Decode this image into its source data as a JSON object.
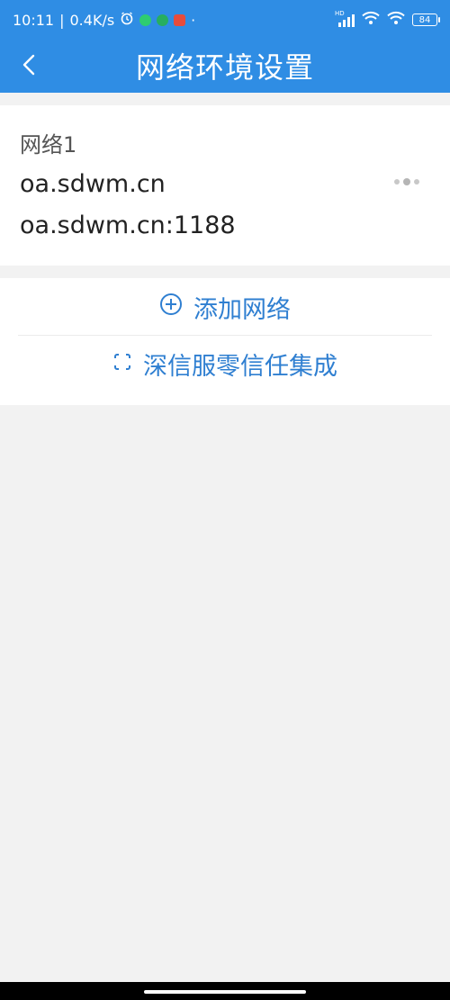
{
  "status_bar": {
    "time": "10:11",
    "separator": "|",
    "speed": "0.4K/s",
    "dot": "·",
    "battery": "84",
    "network_badge": "HD",
    "icons": [
      "alarm-icon",
      "wechat-icon",
      "phone-icon",
      "mi-icon",
      "signal-icon",
      "wifi-icon",
      "wifi-icon",
      "battery-icon"
    ]
  },
  "header": {
    "title": "网络环境设置",
    "back_icon": "chevron-left-icon",
    "background_color": "#2f8de4"
  },
  "network": {
    "name": "网络1",
    "host": "oa.sdwm.cn",
    "address": "oa.sdwm.cn:1188",
    "menu_icon": "more-dots-icon"
  },
  "actions": {
    "add_network": "添加网络",
    "add_icon": "plus-circle-icon",
    "sangfor_zero_trust": "深信服零信任集成",
    "sangfor_icon": "focus-frame-icon",
    "accent_color": "#2f7fd1"
  }
}
